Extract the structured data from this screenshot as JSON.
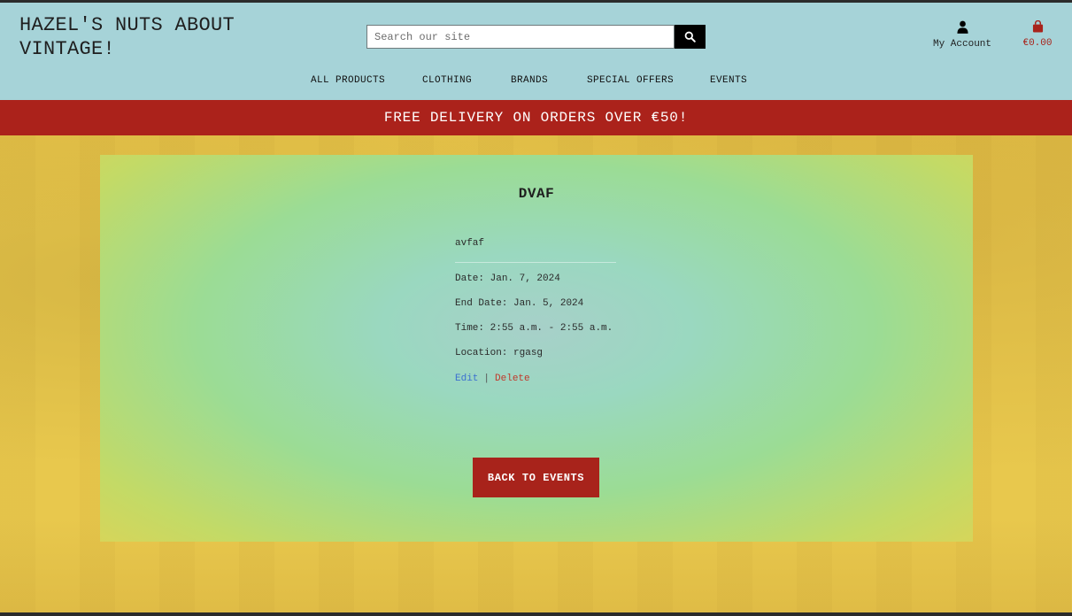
{
  "brand": {
    "line1": "HAZEL'S NUTS ABOUT",
    "line2": "VINTAGE!"
  },
  "search": {
    "placeholder": "Search our site",
    "icon": "search-icon"
  },
  "account": {
    "label": "My Account",
    "icon": "user-icon"
  },
  "bag": {
    "total": "€0.00",
    "icon": "shopping-bag-icon"
  },
  "nav": [
    {
      "label": "ALL PRODUCTS"
    },
    {
      "label": "CLOTHING"
    },
    {
      "label": "BRANDS"
    },
    {
      "label": "SPECIAL OFFERS"
    },
    {
      "label": "EVENTS"
    }
  ],
  "banner": {
    "text": "FREE DELIVERY ON ORDERS OVER €50!"
  },
  "event": {
    "title": "DVAF",
    "description": "avfaf",
    "date_label": "Date:",
    "date": "Jan. 7, 2024",
    "end_date_label": "End Date:",
    "end_date": "Jan. 5, 2024",
    "time_label": "Time:",
    "time": "2:55 a.m. - 2:55 a.m.",
    "location_label": "Location:",
    "location": "rgasg"
  },
  "actions": {
    "edit": "Edit",
    "separator": "|",
    "delete": "Delete"
  },
  "back_button": "BACK TO EVENTS",
  "colors": {
    "header": "#a6d3d8",
    "banner": "#ab221b",
    "accent": "#a8231b",
    "background": "#e8c84d"
  }
}
